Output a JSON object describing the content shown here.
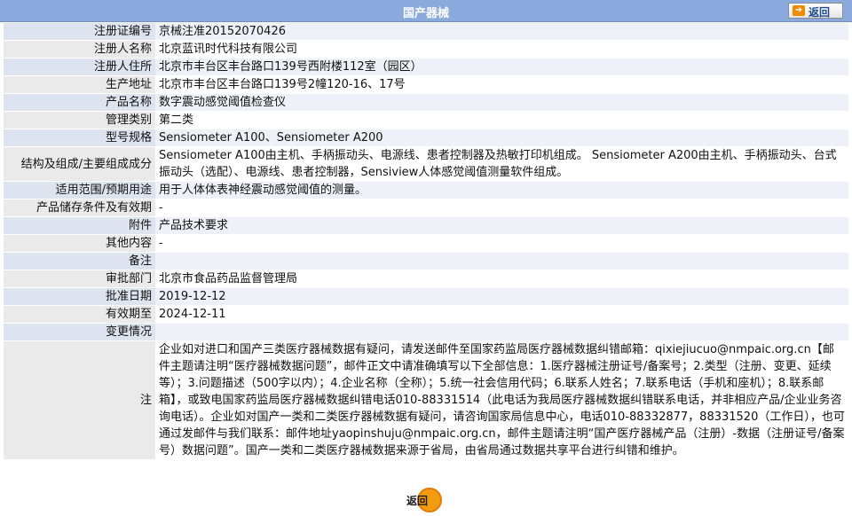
{
  "header": {
    "title": "国产器械",
    "back_label": "返回"
  },
  "rows": [
    {
      "label": "注册证编号",
      "value": "京械注准20152070426"
    },
    {
      "label": "注册人名称",
      "value": "北京蓝讯时代科技有限公司"
    },
    {
      "label": "注册人住所",
      "value": "北京市丰台区丰台路口139号西附楼112室（园区）"
    },
    {
      "label": "生产地址",
      "value": "北京市丰台区丰台路口139号2幢120-16、17号"
    },
    {
      "label": "产品名称",
      "value": "数字震动感觉阈值检查仪"
    },
    {
      "label": "管理类别",
      "value": "第二类"
    },
    {
      "label": "型号规格",
      "value": "Sensiometer A100、Sensiometer A200"
    },
    {
      "label": "结构及组成/主要组成成分",
      "value": "Sensiometer A100由主机、手柄振动头、电源线、患者控制器及热敏打印机组成。 Sensiometer A200由主机、手柄振动头、台式振动头（选配）、电源线、患者控制器，Sensiview人体感觉阈值测量软件组成。"
    },
    {
      "label": "适用范围/预期用途",
      "value": "用于人体体表神经震动感觉阈值的测量。"
    },
    {
      "label": "产品储存条件及有效期",
      "value": "-"
    },
    {
      "label": "附件",
      "value": "产品技术要求"
    },
    {
      "label": "其他内容",
      "value": "-"
    },
    {
      "label": "备注",
      "value": ""
    },
    {
      "label": "审批部门",
      "value": "北京市食品药品监督管理局"
    },
    {
      "label": "批准日期",
      "value": "2019-12-12"
    },
    {
      "label": "有效期至",
      "value": "2024-12-11"
    },
    {
      "label": "变更情况",
      "value": ""
    },
    {
      "label": "注",
      "value": "企业如对进口和国产三类医疗器械数据有疑问，请发送邮件至国家药监局医疗器械数据纠错邮箱：qixiejiucuo@nmpaic.org.cn【邮件主题请注明“医疗器械数据问题”，邮件正文中请准确填写以下全部信息：1.医疗器械注册证号/备案号；2.类型（注册、变更、延续等）；3.问题描述（500字以内）；4.企业名称（全称）；5.统一社会信用代码；6.联系人姓名；7.联系电话（手机和座机）；8.联系邮箱】，或致电国家药监局医疗器械数据纠错电话010-88331514（此电话为我局医疗器械数据纠错联系电话，并非相应产品/企业业务咨询电话）。企业如对国产一类和二类医疗器械数据有疑问，请咨询国家局信息中心，电话010-88332877，88331520（工作日），也可通过发邮件与我们联系：邮件地址yaopinshuju@nmpaic.org.cn，邮件主题请注明“国产医疗器械产品（注册）-数据（注册证号/备案号）数据问题”。国产一类和二类医疗器械数据来源于省局，由省局通过数据共享平台进行纠错和维护。"
    }
  ],
  "footer": {
    "back_label": "返回"
  }
}
